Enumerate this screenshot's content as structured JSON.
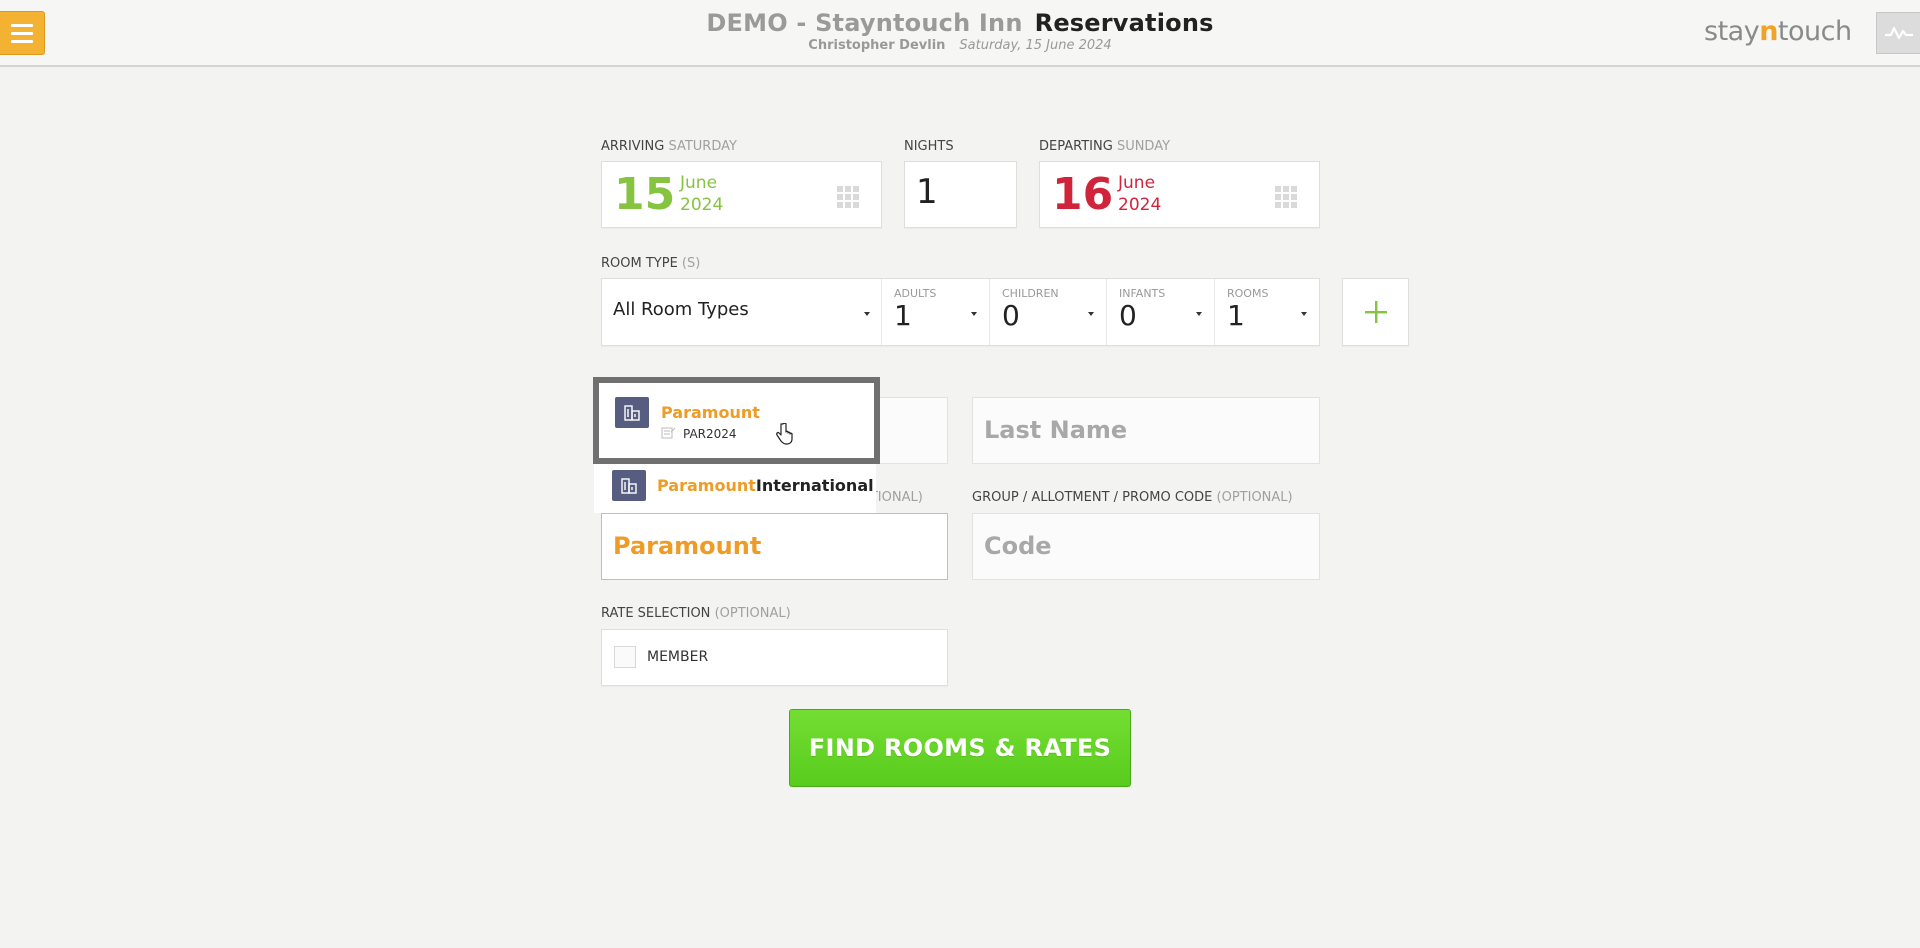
{
  "header": {
    "hotel_name": "DEMO - Stayntouch Inn",
    "module_title": "Reservations",
    "user_name": "Christopher Devlin",
    "business_date": "Saturday, 15 June 2024",
    "logo_prefix": "stay",
    "logo_n": "n",
    "logo_suffix": "touch"
  },
  "arrival": {
    "label": "ARRIVING",
    "weekday": "SATURDAY",
    "day": "15",
    "month": "June",
    "year": "2024"
  },
  "nights": {
    "label": "NIGHTS",
    "value": "1"
  },
  "departure": {
    "label": "DEPARTING",
    "weekday": "SUNDAY",
    "day": "16",
    "month": "June",
    "year": "2024"
  },
  "room_type": {
    "label": "ROOM TYPE",
    "label_suffix": "(S)",
    "selected": "All Room Types"
  },
  "occupancy": {
    "adults_label": "ADULTS",
    "adults": "1",
    "children_label": "CHILDREN",
    "children": "0",
    "infants_label": "INFANTS",
    "infants": "0",
    "rooms_label": "ROOMS",
    "rooms": "1"
  },
  "guest": {
    "last_name_placeholder": "Last Name"
  },
  "company": {
    "label_suffix": "PTIONAL)",
    "typed_value": "Paramount"
  },
  "promo": {
    "label": "GROUP / ALLOTMENT / PROMO CODE",
    "label_suffix": "(OPTIONAL)",
    "placeholder": "Code"
  },
  "autocomplete": [
    {
      "highlight": "Paramount",
      "rest": "",
      "code": "PAR2024"
    },
    {
      "highlight": "Paramount",
      "rest": "International",
      "code": ""
    }
  ],
  "rate_selection": {
    "label": "RATE SELECTION",
    "label_suffix": "(OPTIONAL)",
    "option": "MEMBER"
  },
  "actions": {
    "find_label": "FIND ROOMS & RATES"
  },
  "colors": {
    "accent_orange": "#ef9c27",
    "arrival_green": "#85c341",
    "departure_red": "#d0243b",
    "button_green": "#62d325",
    "menu_yellow": "#f4b233"
  }
}
